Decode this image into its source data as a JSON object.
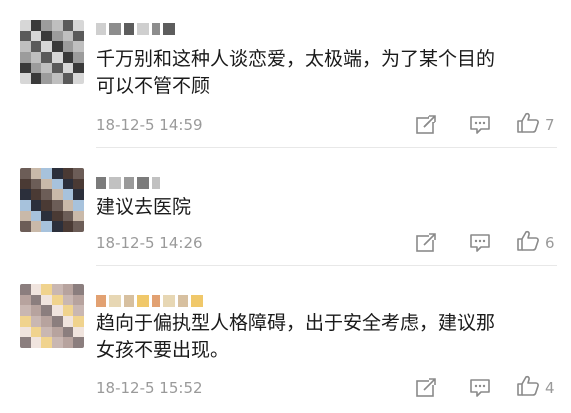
{
  "comments": [
    {
      "text": "千万别和这种人谈恋爱，太极端，为了某个目的\n可以不管不顾",
      "time": "18-12-5 14:59",
      "likes": "7",
      "avatar_colors": [
        "#d7d7d7",
        "#9c9c9c",
        "#5a5a5a",
        "#3a3a3a",
        "#bfbfbf"
      ],
      "name_colors": [
        "#cfcfcf",
        "#8d8d8d",
        "#5d5d5d"
      ]
    },
    {
      "text": "建议去医院",
      "time": "18-12-5 14:26",
      "likes": "6",
      "avatar_colors": [
        "#2b2f3b",
        "#6c5d57",
        "#a7c2dc",
        "#4a3a34",
        "#c9b9a9"
      ],
      "name_colors": [
        "#7b7b7b",
        "#c1c1c1",
        "#9a9a9a"
      ]
    },
    {
      "text": "趋向于偏执型人格障碍，出于安全考虑，建议那\n女孩不要出现。",
      "time": "18-12-5 15:52",
      "likes": "4",
      "avatar_colors": [
        "#f0e4de",
        "#c9b7b2",
        "#8b7e7e",
        "#f0d38e",
        "#b7a39e"
      ],
      "name_colors": [
        "#e2a172",
        "#e7d7b4",
        "#d7c0a0",
        "#f0c86a"
      ]
    }
  ],
  "icons": {
    "share": "share-icon",
    "comment": "comment-icon",
    "like": "thumbs-up-icon"
  }
}
